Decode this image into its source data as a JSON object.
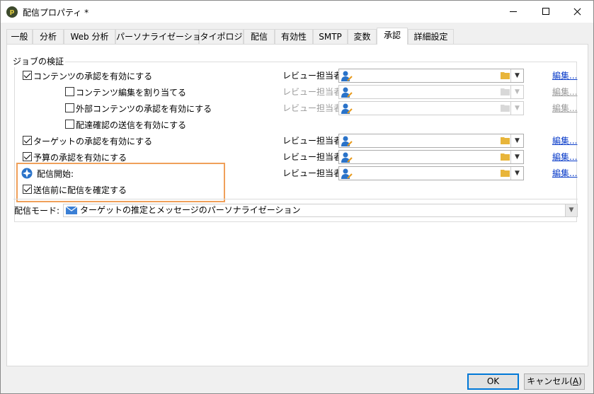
{
  "window": {
    "title": "配信プロパティ *"
  },
  "tabs": [
    {
      "label": "一般"
    },
    {
      "label": "分析"
    },
    {
      "label": "Web 分析"
    },
    {
      "label": "パーソナライゼーション"
    },
    {
      "label": "タイポロジ"
    },
    {
      "label": "配信"
    },
    {
      "label": "有効性"
    },
    {
      "label": "SMTP"
    },
    {
      "label": "変数"
    },
    {
      "label": "承認"
    },
    {
      "label": "詳細設定"
    }
  ],
  "active_tab": "承認",
  "job_validation": {
    "group_title": "ジョブの検証",
    "rows": [
      {
        "label": "コンテンツの承認を有効にする",
        "checked": true,
        "reviewer_label": "レビュー担当者:",
        "edit_label": "編集...",
        "enabled": true
      },
      {
        "label": "コンテンツ編集を割り当てる",
        "checked": false,
        "reviewer_label": "レビュー担当者:",
        "edit_label": "編集...",
        "enabled": false
      },
      {
        "label": "外部コンテンツの承認を有効にする",
        "checked": false,
        "reviewer_label": "レビュー担当者:",
        "edit_label": "編集...",
        "enabled": false
      },
      {
        "label": "配達確認の送信を有効にする",
        "checked": false
      },
      {
        "label": "ターゲットの承認を有効にする",
        "checked": true,
        "reviewer_label": "レビュー担当者:",
        "edit_label": "編集...",
        "enabled": true
      },
      {
        "label": "予算の承認を有効にする",
        "checked": true,
        "reviewer_label": "レビュー担当者:",
        "edit_label": "編集...",
        "enabled": true
      },
      {
        "label": "配信開始:",
        "icon": "delivery-start-icon",
        "reviewer_label": "レビュー担当者:",
        "edit_label": "編集...",
        "enabled": true
      },
      {
        "label": "送信前に配信を確定する",
        "checked": true
      }
    ]
  },
  "delivery_mode": {
    "label": "配信モード:",
    "value": "ターゲットの推定とメッセージのパーソナライゼーション",
    "icon": "mail-icon"
  },
  "buttons": {
    "ok": "OK",
    "cancel_prefix": "キャンセル(",
    "cancel_key": "A",
    "cancel_suffix": ")"
  },
  "colors": {
    "highlight": "#f0a05a",
    "link": "#0a3cc9",
    "default_button_border": "#0078d7"
  }
}
